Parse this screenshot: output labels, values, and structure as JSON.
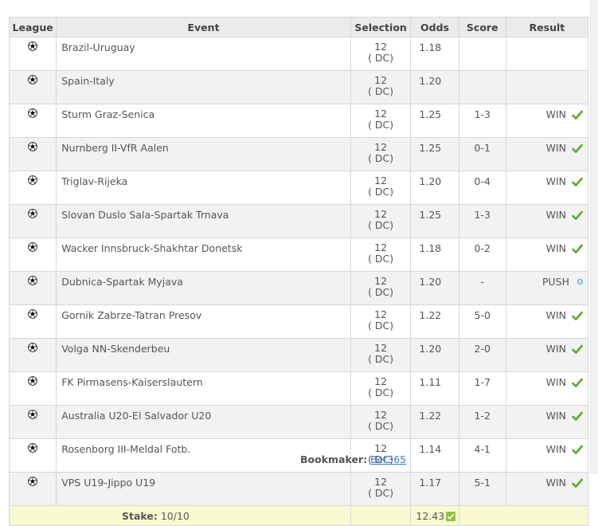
{
  "headers": {
    "league": "League",
    "event": "Event",
    "selection": "Selection",
    "odds": "Odds",
    "score": "Score",
    "result": "Result"
  },
  "bets": [
    {
      "sport_icon": "soccer-ball-icon",
      "event": "Brazil-Uruguay",
      "selection": "12",
      "selection_note": "( DC)",
      "odds": "1.18",
      "score": "",
      "result": "",
      "result_icon": ""
    },
    {
      "sport_icon": "soccer-ball-icon",
      "event": "Spain-Italy",
      "selection": "12",
      "selection_note": "( DC)",
      "odds": "1.20",
      "score": "",
      "result": "",
      "result_icon": ""
    },
    {
      "sport_icon": "soccer-ball-icon",
      "event": "Sturm Graz-Senica",
      "selection": "12",
      "selection_note": "( DC)",
      "odds": "1.25",
      "score": "1-3",
      "result": "WIN",
      "result_icon": "check-icon"
    },
    {
      "sport_icon": "soccer-ball-icon",
      "event": "Nurnberg II-VfR Aalen",
      "selection": "12",
      "selection_note": "( DC)",
      "odds": "1.25",
      "score": "0-1",
      "result": "WIN",
      "result_icon": "check-icon"
    },
    {
      "sport_icon": "soccer-ball-icon",
      "event": "Triglav-Rijeka",
      "selection": "12",
      "selection_note": "( DC)",
      "odds": "1.20",
      "score": "0-4",
      "result": "WIN",
      "result_icon": "check-icon"
    },
    {
      "sport_icon": "soccer-ball-icon",
      "event": "Slovan Duslo Sala-Spartak Trnava",
      "selection": "12",
      "selection_note": "( DC)",
      "odds": "1.25",
      "score": "1-3",
      "result": "WIN",
      "result_icon": "check-icon"
    },
    {
      "sport_icon": "soccer-ball-icon",
      "event": "Wacker Innsbruck-Shakhtar Donetsk",
      "selection": "12",
      "selection_note": "( DC)",
      "odds": "1.18",
      "score": "0-2",
      "result": "WIN",
      "result_icon": "check-icon"
    },
    {
      "sport_icon": "soccer-ball-icon",
      "event": "Dubnica-Spartak Myjava",
      "selection": "12",
      "selection_note": "( DC)",
      "odds": "1.20",
      "score": "-",
      "result": "PUSH",
      "result_icon": "push-dot-icon"
    },
    {
      "sport_icon": "soccer-ball-icon",
      "event": "Gornik Zabrze-Tatran Presov",
      "selection": "12",
      "selection_note": "( DC)",
      "odds": "1.22",
      "score": "5-0",
      "result": "WIN",
      "result_icon": "check-icon"
    },
    {
      "sport_icon": "soccer-ball-icon",
      "event": "Volga NN-Skenderbeu",
      "selection": "12",
      "selection_note": "( DC)",
      "odds": "1.20",
      "score": "2-0",
      "result": "WIN",
      "result_icon": "check-icon"
    },
    {
      "sport_icon": "soccer-ball-icon",
      "event": "FK Pirmasens-Kaiserslautern",
      "selection": "12",
      "selection_note": "( DC)",
      "odds": "1.11",
      "score": "1-7",
      "result": "WIN",
      "result_icon": "check-icon"
    },
    {
      "sport_icon": "soccer-ball-icon",
      "event": "Australia U20-El Salvador U20",
      "selection": "12",
      "selection_note": "( DC)",
      "odds": "1.22",
      "score": "1-2",
      "result": "WIN",
      "result_icon": "check-icon"
    },
    {
      "sport_icon": "soccer-ball-icon",
      "event": "Rosenborg III-Meldal Fotb.",
      "selection": "12",
      "selection_note": "( DC)",
      "odds": "1.14",
      "score": "4-1",
      "result": "WIN",
      "result_icon": "check-icon"
    },
    {
      "sport_icon": "soccer-ball-icon",
      "event": "VPS U19-Jippo U19",
      "selection": "12",
      "selection_note": "( DC)",
      "odds": "1.17",
      "score": "5-1",
      "result": "WIN",
      "result_icon": "check-icon"
    }
  ],
  "footer": {
    "stake_label": "Stake:",
    "stake_value": "10/10",
    "bookmaker_label": "Bookmaker:",
    "bookmaker_name": "Bet365",
    "total_odds": "12.43",
    "total_icon": "check-box-icon"
  },
  "colors": {
    "win_check": "#5aaa2a",
    "push_dot": "#4a9fd9",
    "footer_bg": "#fafad2",
    "header_bg": "#ebebeb",
    "link": "#3a7bbf"
  }
}
